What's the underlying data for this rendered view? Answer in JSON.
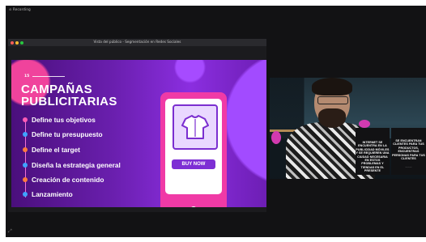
{
  "recording_label": "⊙ Recording",
  "window": {
    "title": "Vista del público - Segmentación en Redes Sociales",
    "traffic_lights": [
      "#ff5f57",
      "#febc2e",
      "#28c840"
    ]
  },
  "slide": {
    "page_number": "15",
    "title_line1": "CAMPAÑAS",
    "title_line2": "PUBLICITARIAS",
    "steps": [
      {
        "label": "Define tus objetivos",
        "color": "#ff5bb5"
      },
      {
        "label": "Define tu presupuesto",
        "color": "#3fa3ff"
      },
      {
        "label": "Define el target",
        "color": "#ff7a3d"
      },
      {
        "label": "Diseña la estrategia general",
        "color": "#3fa3ff"
      },
      {
        "label": "Creación de contenido",
        "color": "#ff7a3d"
      },
      {
        "label": "Lanzamiento",
        "color": "#3fa3ff"
      }
    ],
    "phone_button": "BUY NOW",
    "icons": [
      "tshirt-icon"
    ]
  },
  "webcam": {
    "panel_left_text": "INTERNET SE ENCUENTRA EN LA PUBLICIDAD MÓVILES Y SE REQUIEREN UNA CIUDAD NECESARIA EN ESTOS PROBLEMAS Y TIENDAS EN EL PRESENTE",
    "panel_right_text": "SE ENCUENTRAN CLIENTES PARA TUS PRODUCTOS, ENCUENTRAS PERSONAS PARA TUS CLIENTES",
    "panel_sub": "———"
  },
  "colors": {
    "slide_accent": "#8b2ee0",
    "phone_pink": "#f03aa6"
  }
}
